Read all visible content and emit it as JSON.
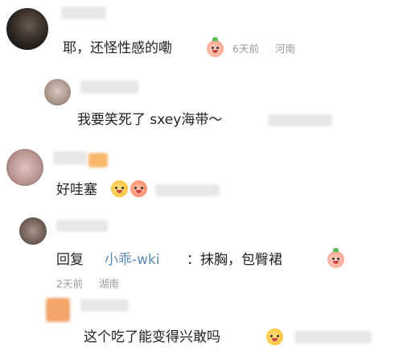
{
  "comments": [
    {
      "text": "耶，还怪性感的嘞",
      "time": "6天前",
      "location": "河南"
    },
    {
      "text": "我要笑死了 sxey海带～"
    },
    {
      "text": "好哇塞"
    },
    {
      "reply_prefix": "回复",
      "reply_user": "小乖-wki",
      "text": "：抹胸，包臀裙",
      "time": "2天前",
      "location": "湖南"
    },
    {
      "text": "这个吃了能变得兴敢吗"
    }
  ]
}
